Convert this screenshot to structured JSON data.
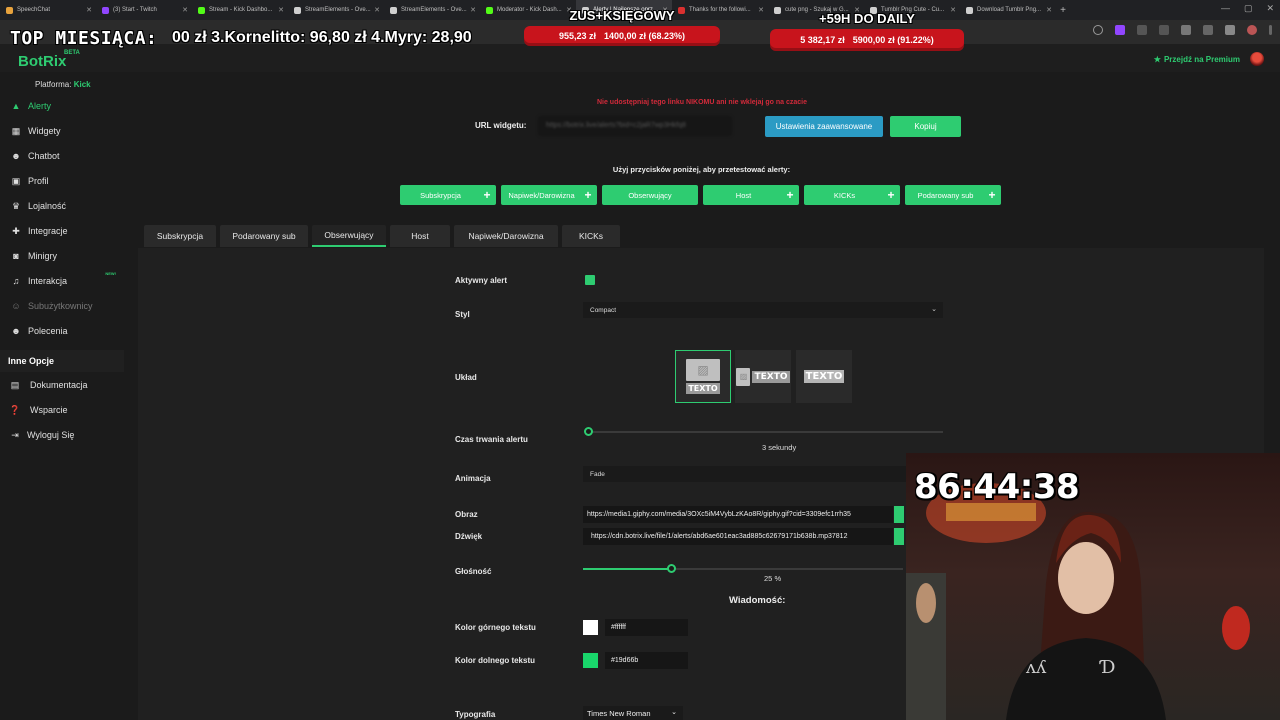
{
  "browser": {
    "tabs": [
      {
        "label": "SpeechChat",
        "color": "#e8a33d"
      },
      {
        "label": "(3) Start - Twitch",
        "color": "#9146ff"
      },
      {
        "label": "Stream - Kick Dashbo...",
        "color": "#53fc18"
      },
      {
        "label": "StreamElements - Ove...",
        "color": "#cfcfcf"
      },
      {
        "label": "StreamElements - Ove...",
        "color": "#cfcfcf"
      },
      {
        "label": "Moderator - Kick Dash...",
        "color": "#53fc18"
      },
      {
        "label": "Alerty | Najlepsze oprz...",
        "color": "#cfcfcf",
        "active": true
      },
      {
        "label": "Thanks for the followi...",
        "color": "#d9302f"
      },
      {
        "label": "cute png - Szukaj w G...",
        "color": "#cfcfcf"
      },
      {
        "label": "Tumblr Png Cute - Cu...",
        "color": "#cfcfcf"
      },
      {
        "label": "Download Tumblr Png...",
        "color": "#cfcfcf"
      }
    ]
  },
  "overlay": {
    "top_label": "TOP MIESIĄCA:",
    "ticker": "00 zł  3.Kornelitto: 96,80 zł  4.Myry: 28,90",
    "goal1": {
      "title": "ZUS+KSIĘGOWY",
      "current": "955,23 zł",
      "target": "1400,00 zł (68.23%)",
      "progress": 0.6823
    },
    "goal2": {
      "title": "+59H DO DAILY",
      "current": "5 382,17 zł",
      "target": "5900,00 zł (91.22%)",
      "progress": 0.9122
    },
    "timer": "86:44:38"
  },
  "header": {
    "logo": "BotRix",
    "beta": "BETA",
    "premium": "Przejdź na Premium"
  },
  "sidebar": {
    "platform_label": "Platforma:",
    "platform_value": "Kick",
    "items": [
      {
        "label": "Alerty",
        "icon": "alert-triangle-icon",
        "active": true
      },
      {
        "label": "Widgety",
        "icon": "grid-icon"
      },
      {
        "label": "Chatbot",
        "icon": "robot-icon"
      },
      {
        "label": "Profil",
        "icon": "profile-icon"
      },
      {
        "label": "Lojalność",
        "icon": "trophy-icon"
      },
      {
        "label": "Integracje",
        "icon": "puzzle-icon"
      },
      {
        "label": "Minigry",
        "icon": "gamepad-icon"
      },
      {
        "label": "Interakcja",
        "icon": "music-icon",
        "badge": "NEW!"
      },
      {
        "label": "Subużytkownicy",
        "icon": "users-icon",
        "disabled": true
      },
      {
        "label": "Polecenia",
        "icon": "people-icon"
      }
    ],
    "section_title": "Inne Opcje",
    "other_items": [
      {
        "label": "Dokumentacja",
        "icon": "document-icon"
      },
      {
        "label": "Wsparcie",
        "icon": "help-icon"
      },
      {
        "label": "Wyloguj Się",
        "icon": "logout-icon"
      }
    ]
  },
  "main": {
    "warning": "Nie udostępniaj tego linku NIKOMU ani nie wklejaj go na czacie",
    "url_label": "URL widgetu:",
    "url_value": "https://botrix.live/alerts?bid=c2jaR7wp3Hkfq8",
    "advanced_button": "Ustawienia zaawansowane",
    "copy_button": "Kopiuj",
    "test_label": "Użyj przycisków poniżej, aby przetestować alerty:",
    "test_buttons": [
      "Subskrypcja",
      "Napiwek/Darowizna",
      "Obserwujący",
      "Host",
      "KICKs",
      "Podarowany sub"
    ],
    "tabs": [
      "Subskrypcja",
      "Podarowany sub",
      "Obserwujący",
      "Host",
      "Napiwek/Darowizna",
      "KICKs"
    ],
    "active_tab": "Obserwujący",
    "form": {
      "active_label": "Aktywny alert",
      "active_value": true,
      "style_label": "Styl",
      "style_value": "Compact",
      "layout_label": "Układ",
      "layout_text": "TEXTO",
      "duration_label": "Czas trwania alertu",
      "duration_value": "3",
      "duration_unit": "sekundy",
      "duration_fraction": 0.0,
      "animation_label": "Animacja",
      "animation_value": "Fade",
      "image_label": "Obraz",
      "image_value": "https://media1.giphy.com/media/3OXc5iM4VybLzKAo8R/giphy.gif?cid=3309efc1rrh35",
      "sound_label": "Dźwięk",
      "sound_value": "https://cdn.botrix.live/file/1/alerts/abd6ae601eac3ad885c62679171b638b.mp37812",
      "volume_label": "Głośność",
      "volume_value": "25",
      "volume_unit": "%",
      "volume_fraction": 0.25,
      "message_heading": "Wiadomość:",
      "top_color_label": "Kolor górnego tekstu",
      "top_color_value": "#ffffff",
      "bottom_color_label": "Kolor dolnego tekstu",
      "bottom_color_value": "#19d66b",
      "font_label": "Typografia",
      "font_value": "Times New Roman"
    }
  },
  "colors": {
    "accent": "#2ecc71",
    "advanced": "#2b9bc4",
    "warning": "#d12a3a",
    "goal_bar": "#c8141c"
  }
}
